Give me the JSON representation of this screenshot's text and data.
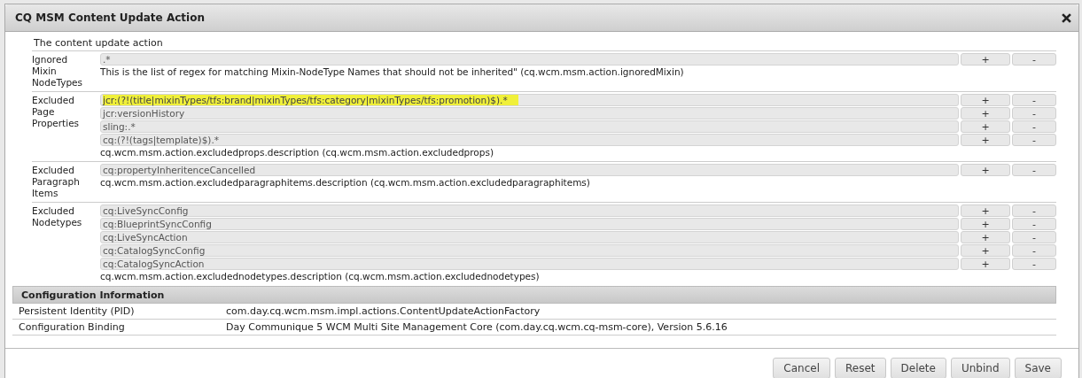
{
  "dialog": {
    "title": "CQ MSM Content Update Action",
    "description": "The content update action"
  },
  "properties": [
    {
      "label": "Ignored Mixin NodeTypes",
      "values": [
        {
          "text": ".*",
          "highlighted": false
        }
      ],
      "description": "This is the list of regex for matching Mixin-NodeType Names that should not be inherited\" (cq.wcm.msm.action.ignoredMixin)"
    },
    {
      "label": "Excluded Page Properties",
      "values": [
        {
          "text": "jcr:(?!(title|mixinTypes/tfs:brand|mixinTypes/tfs:category|mixinTypes/tfs:promotion)$).*",
          "highlighted": true
        },
        {
          "text": "jcr:versionHistory",
          "highlighted": false
        },
        {
          "text": "sling:.*",
          "highlighted": false
        },
        {
          "text": "cq:(?!(tags|template)$).*",
          "highlighted": false
        }
      ],
      "description": "cq.wcm.msm.action.excludedprops.description (cq.wcm.msm.action.excludedprops)"
    },
    {
      "label": "Excluded Paragraph Items",
      "values": [
        {
          "text": "cq:propertyInheritenceCancelled",
          "highlighted": false
        }
      ],
      "description": "cq.wcm.msm.action.excludedparagraphitems.description (cq.wcm.msm.action.excludedparagraphitems)"
    },
    {
      "label": "Excluded Nodetypes",
      "values": [
        {
          "text": "cq:LiveSyncConfig",
          "highlighted": false
        },
        {
          "text": "cq:BlueprintSyncConfig",
          "highlighted": false
        },
        {
          "text": "cq:LiveSyncAction",
          "highlighted": false
        },
        {
          "text": "cq:CatalogSyncConfig",
          "highlighted": false
        },
        {
          "text": "cq:CatalogSyncAction",
          "highlighted": false
        }
      ],
      "description": "cq.wcm.msm.action.excludednodetypes.description (cq.wcm.msm.action.excludednodetypes)"
    }
  ],
  "add_label": "+",
  "remove_label": "-",
  "configuration_information": {
    "title": "Configuration Information",
    "rows": [
      {
        "name": "Persistent Identity (PID)",
        "value": "com.day.cq.wcm.msm.impl.actions.ContentUpdateActionFactory"
      },
      {
        "name": "Configuration Binding",
        "value": "Day Communique 5 WCM Multi Site Management Core (com.day.cq.wcm.cq-msm-core), Version 5.6.16"
      }
    ]
  },
  "buttons": [
    "Cancel",
    "Reset",
    "Delete",
    "Unbind",
    "Save"
  ]
}
